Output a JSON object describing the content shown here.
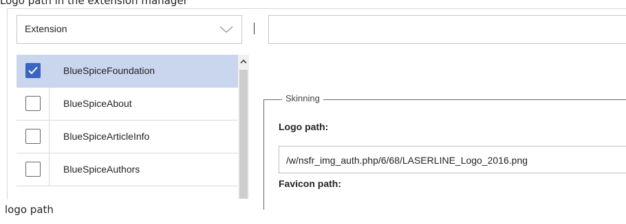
{
  "top_caption": "Logo path in the extension manager",
  "filter": {
    "dropdown_value": "Extension",
    "separator": "|",
    "search_value": ""
  },
  "extensions": [
    {
      "name": "BlueSpiceFoundation",
      "checked": true
    },
    {
      "name": "BlueSpiceAbout",
      "checked": false
    },
    {
      "name": "BlueSpiceArticleInfo",
      "checked": false
    },
    {
      "name": "BlueSpiceAuthors",
      "checked": false
    }
  ],
  "settings": {
    "section_title": "Skinning",
    "logo_label": "Logo path:",
    "logo_value": "/w/nsfr_img_auth.php/6/68/LASERLINE_Logo_2016.png",
    "favicon_label": "Favicon path:"
  },
  "bottom_caption": "logo path",
  "colors": {
    "selected_row": "#c9d6ee",
    "checkbox_checked": "#3a64c4"
  },
  "icons": {
    "dropdown": "chevron-down-icon",
    "scroll_up": "chevron-up-icon",
    "check": "check-icon"
  }
}
